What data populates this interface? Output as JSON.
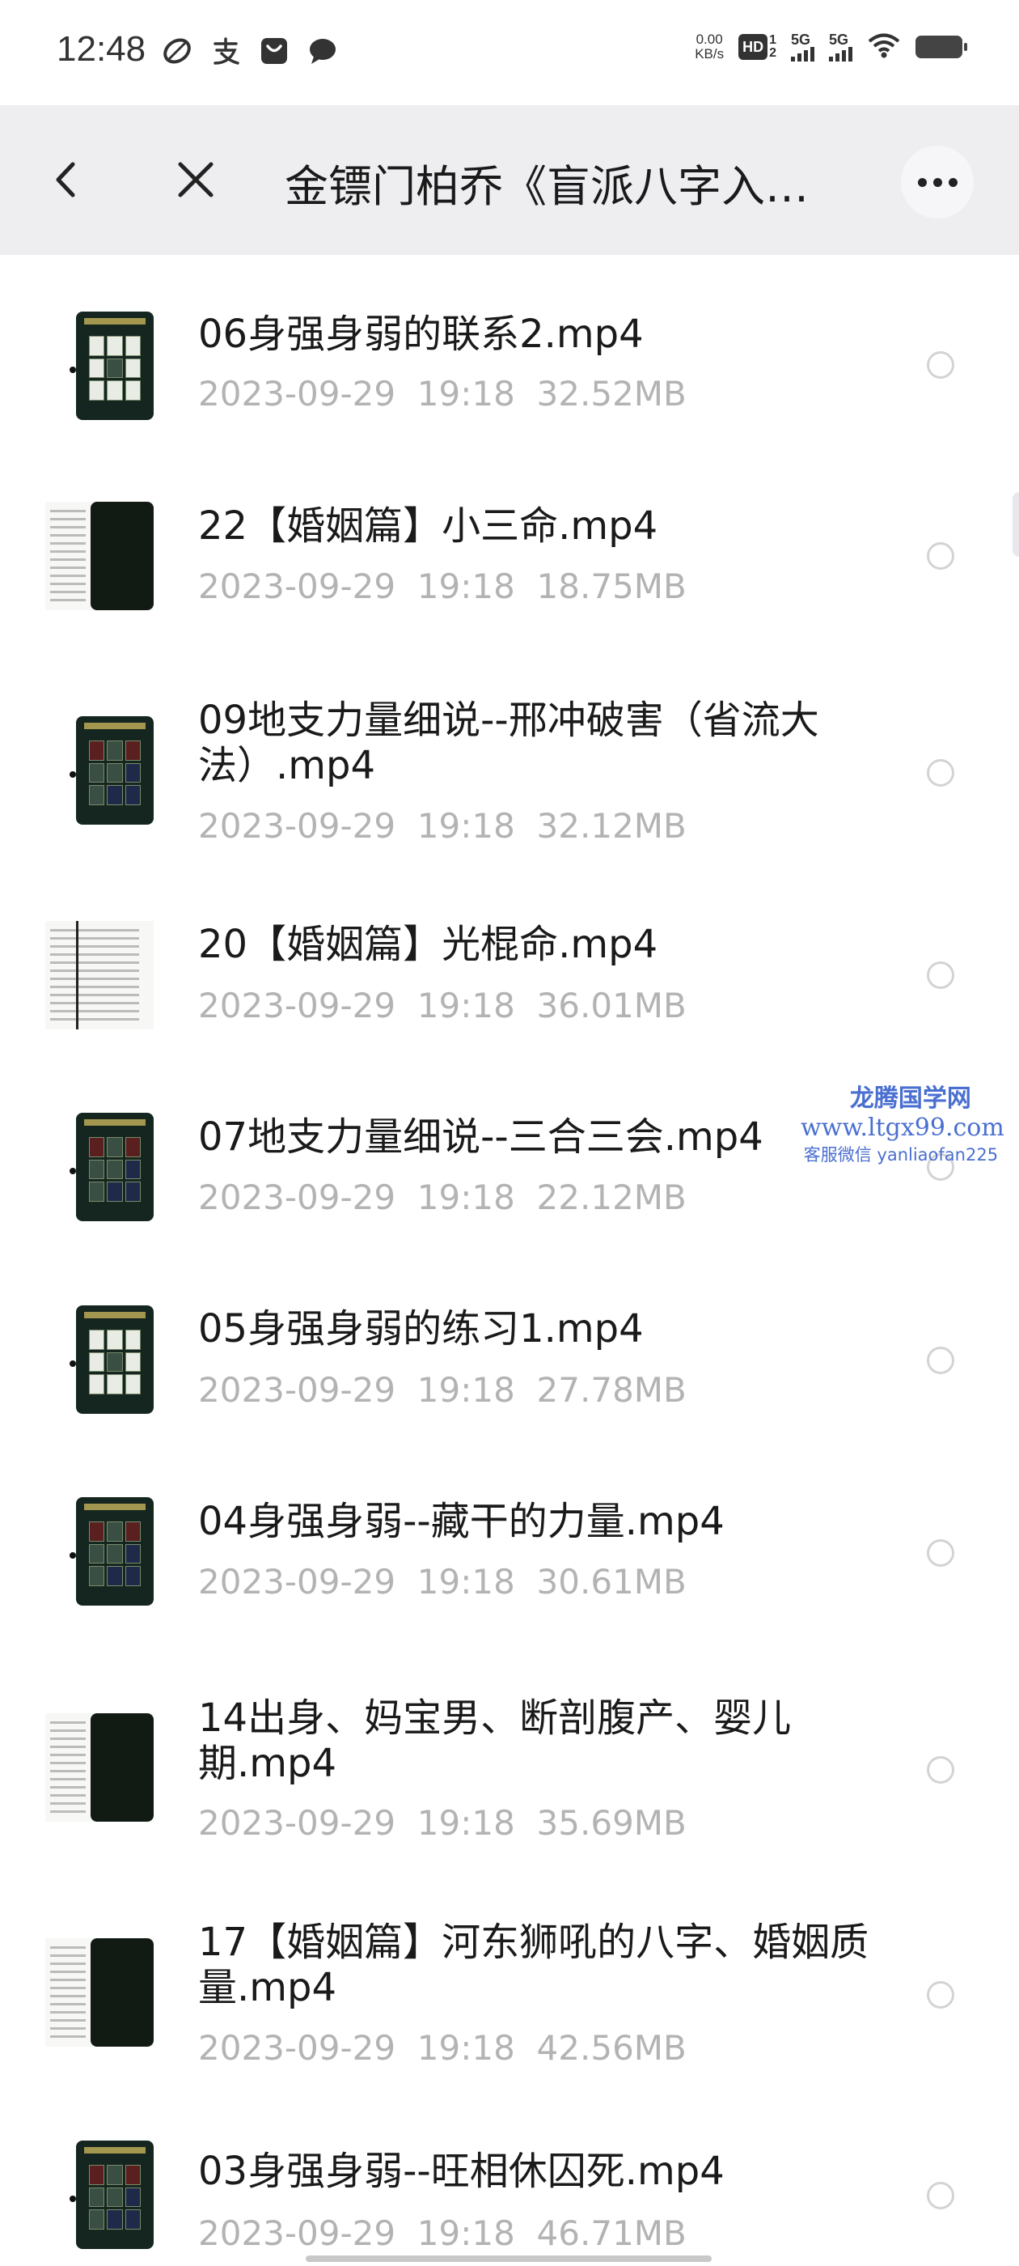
{
  "status_bar": {
    "time": "12:48",
    "net_speed_value": "0.00",
    "net_speed_unit": "KB/s",
    "hd": "HD",
    "hd_sub_top": "1",
    "hd_sub_bottom": "2",
    "signal1": "5G",
    "signal2": "5G"
  },
  "nav": {
    "title": "金镖门柏乔《盲派八字入…"
  },
  "files": [
    {
      "name": "06身强身弱的联系2.mp4",
      "date": "2023-09-29",
      "time": "19:18",
      "size": "32.52MB"
    },
    {
      "name": "22【婚姻篇】小三命.mp4",
      "date": "2023-09-29",
      "time": "19:18",
      "size": "18.75MB"
    },
    {
      "name": "09地支力量细说--邢冲破害（省流大法）.mp4",
      "date": "2023-09-29",
      "time": "19:18",
      "size": "32.12MB"
    },
    {
      "name": "20【婚姻篇】光棍命.mp4",
      "date": "2023-09-29",
      "time": "19:18",
      "size": "36.01MB"
    },
    {
      "name": "07地支力量细说--三合三会.mp4",
      "date": "2023-09-29",
      "time": "19:18",
      "size": "22.12MB"
    },
    {
      "name": "05身强身弱的练习1.mp4",
      "date": "2023-09-29",
      "time": "19:18",
      "size": "27.78MB"
    },
    {
      "name": "04身强身弱--藏干的力量.mp4",
      "date": "2023-09-29",
      "time": "19:18",
      "size": "30.61MB"
    },
    {
      "name": "14出身、妈宝男、断剖腹产、婴儿期.mp4",
      "date": "2023-09-29",
      "time": "19:18",
      "size": "35.69MB"
    },
    {
      "name": "17【婚姻篇】河东狮吼的八字、婚姻质量.mp4",
      "date": "2023-09-29",
      "time": "19:18",
      "size": "42.56MB"
    },
    {
      "name": "03身强身弱--旺相休囚死.mp4",
      "date": "2023-09-29",
      "time": "19:18",
      "size": "46.71MB"
    }
  ],
  "watermark": {
    "line1": "龙腾国学网",
    "line2": "www.ltgx99.com",
    "line3": "客服微信 yanliaofan225"
  }
}
